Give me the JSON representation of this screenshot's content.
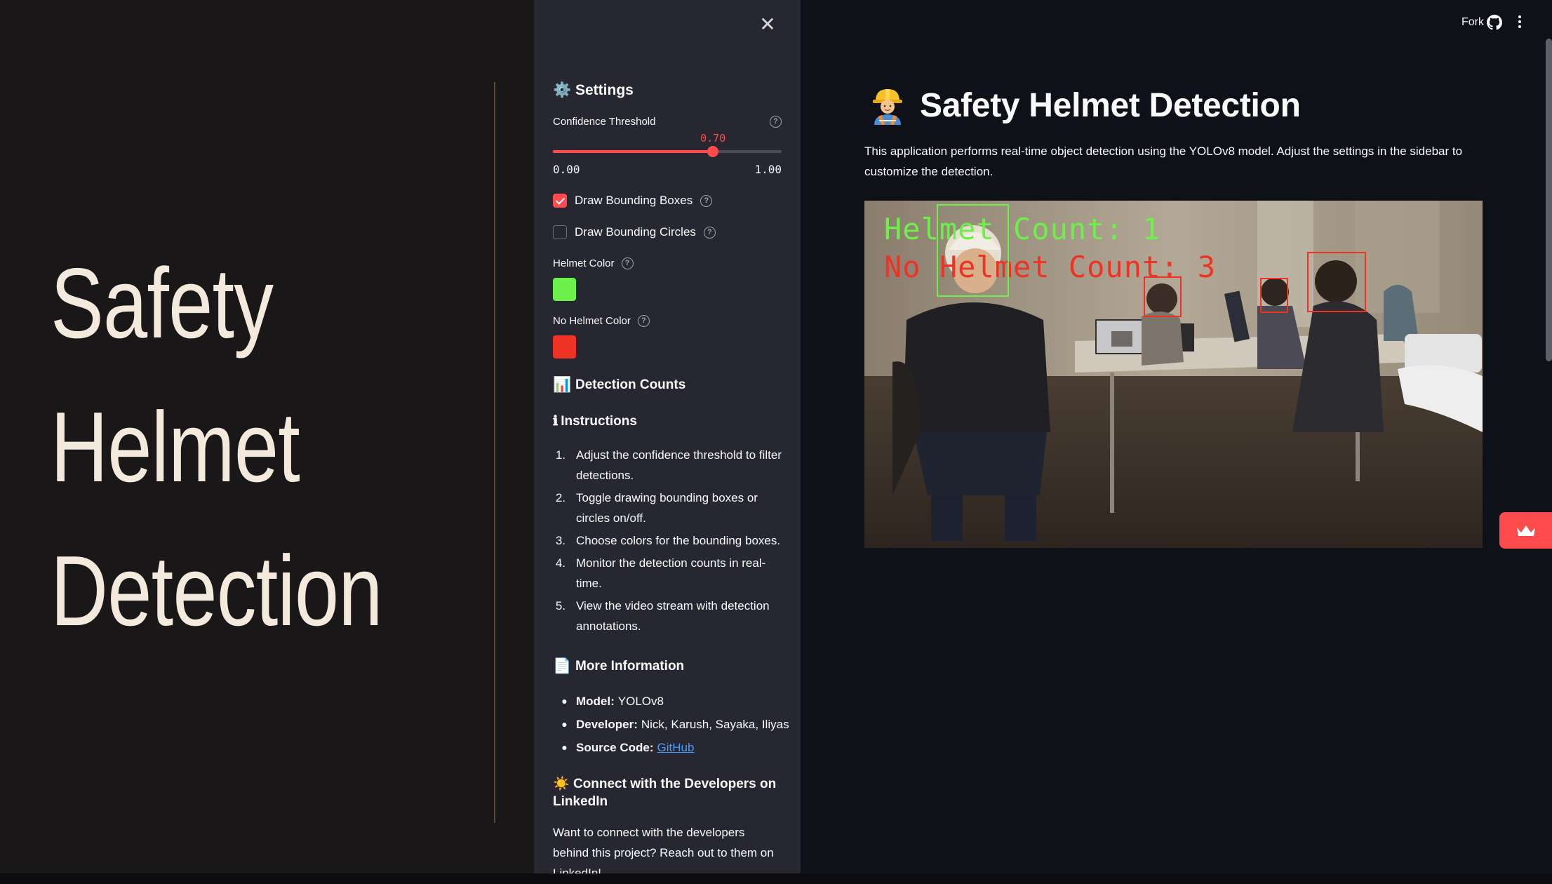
{
  "slide": {
    "title_lines": [
      "Safety",
      "Helmet",
      "Detection"
    ]
  },
  "sidebar": {
    "close_icon": "close-x-icon",
    "settings": {
      "emoji": "⚙️",
      "title": "Settings"
    },
    "confidence": {
      "label": "Confidence Threshold",
      "value": 0.7,
      "value_text": "0.70",
      "min_text": "0.00",
      "max_text": "1.00"
    },
    "checkboxes": [
      {
        "label": "Draw Bounding Boxes",
        "checked": true
      },
      {
        "label": "Draw Bounding Circles",
        "checked": false
      }
    ],
    "helmet_color": {
      "label": "Helmet Color",
      "color": "#6cf04a"
    },
    "no_helmet_color": {
      "label": "No Helmet Color",
      "color": "#ee3324"
    },
    "detection_counts": {
      "emoji": "📊",
      "title": "Detection Counts"
    },
    "instructions": {
      "emoji": "ℹ",
      "title": "Instructions",
      "items": [
        {
          "num": "1.",
          "text": "Adjust the confidence threshold to filter detections."
        },
        {
          "num": "2.",
          "text": "Toggle drawing bounding boxes or circles on/off."
        },
        {
          "num": "3.",
          "text": "Choose colors for the bounding boxes."
        },
        {
          "num": "4.",
          "text": "Monitor the detection counts in real-time."
        },
        {
          "num": "5.",
          "text": "View the video stream with detection annotations."
        }
      ]
    },
    "more_info": {
      "emoji": "📄",
      "title": "More Information",
      "model_label": "Model:",
      "model_value": "YOLOv8",
      "developer_label": "Developer:",
      "developer_value": "Nick, Karush, Sayaka, Iliyas",
      "source_label": "Source Code:",
      "source_link": "GitHub"
    },
    "connect": {
      "emoji": "☀️",
      "title": "Connect with the Developers on LinkedIn",
      "text": "Want to connect with the developers behind this project? Reach out to them on LinkedIn!"
    }
  },
  "main": {
    "toolbar": {
      "fork": "Fork",
      "github_icon": "github-icon",
      "menu_icon": "kebab-menu-icon"
    },
    "title": "Safety Helmet Detection",
    "title_emoji": "👷",
    "description": "This application performs real-time object detection using the YOLOv8 model. Adjust the settings in the sidebar to customize the detection.",
    "video": {
      "helmet_count_text": "Helmet Count: 1",
      "no_helmet_count_text": "No Helmet Count: 3"
    },
    "floating_icon": "crown-icon"
  },
  "colors": {
    "accent": "#ff4b4b",
    "sidebar_bg": "#262730",
    "main_bg": "#0e1117",
    "slide_bg": "#1a1718",
    "slide_text": "#f3e9dc"
  }
}
